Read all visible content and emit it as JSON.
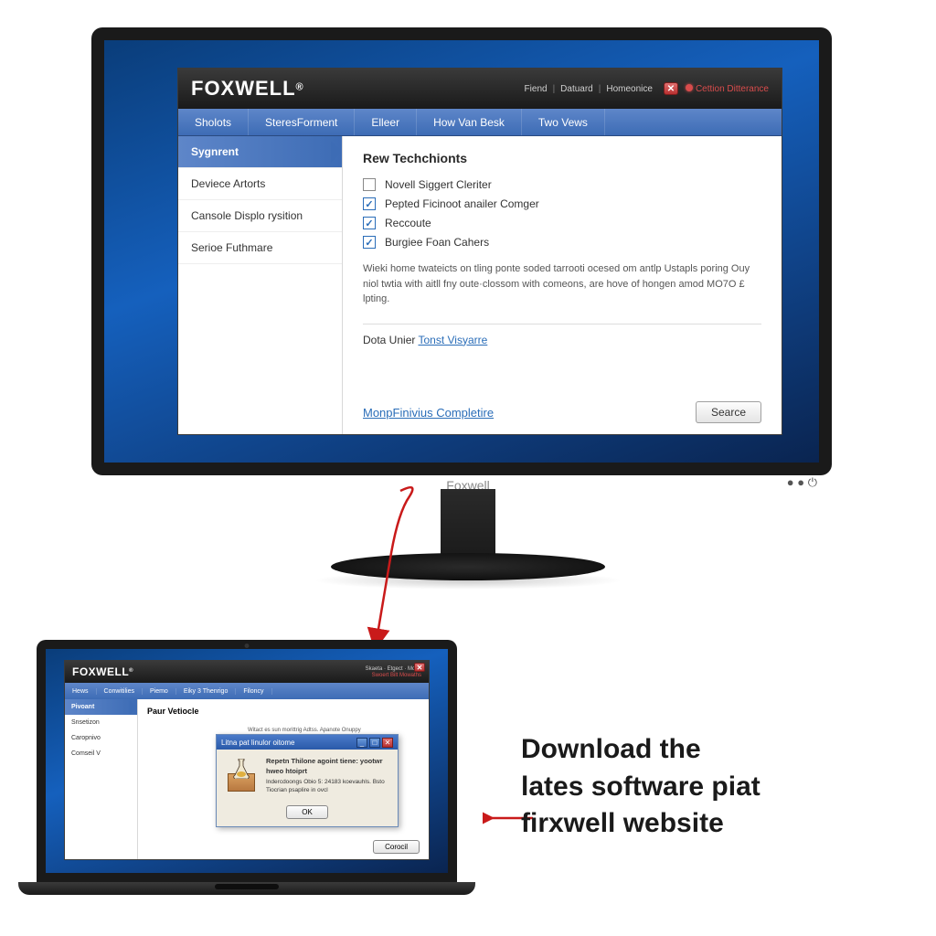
{
  "monitor": {
    "brand": "Foxwell",
    "app": {
      "logo": "FOXWELL",
      "reg": "®",
      "titlebar_links": [
        "Fiend",
        "Datuard",
        "Homeonice"
      ],
      "close_glyph": "✕",
      "status": "Cettion Ditterance",
      "nav": [
        "Sholots",
        "SteresForment",
        "Elleer",
        "How Van Besk",
        "Two Vews"
      ],
      "sidebar": {
        "items": [
          {
            "label": "Sygnrent",
            "active": true
          },
          {
            "label": "Deviece Artorts",
            "active": false
          },
          {
            "label": "Cansole Displo rysition",
            "active": false
          },
          {
            "label": "Serioe Futhmare",
            "active": false
          }
        ]
      },
      "content": {
        "heading": "Rew Techchionts",
        "checks": [
          {
            "checked": false,
            "label": "Novell Siggert Cleriter"
          },
          {
            "checked": true,
            "label": "Pepted Ficinoot anailer Comger"
          },
          {
            "checked": true,
            "label": "Reccoute"
          },
          {
            "checked": true,
            "label": "Burgiee Foan Cahers"
          }
        ],
        "desc": "Wieki home twateicts on tling ponte soded tarrooti ocesed om antlp Ustapls poring Ouy niol twtia with aitll fny oute·clossom with comeons, are hove of hongen amod MO7O £ lpting.",
        "data_label": "Dota Unier",
        "data_link": "Tonst Visyarre",
        "bottom_link": "MonpFinivius Completire",
        "button": "Searce"
      }
    }
  },
  "laptop": {
    "app": {
      "logo": "FOXWELL",
      "reg": "®",
      "titlebar_links": "Skaeta · Etgect · Mode",
      "status": "Swoert Bilt Mowaths",
      "close_glyph": "✕",
      "nav": [
        "Hews",
        "Conwitilies",
        "Piemo",
        "Eiky 3 Thenrigo",
        "Filoncy"
      ],
      "sidebar": {
        "items": [
          {
            "label": "Pivoant",
            "active": true
          },
          {
            "label": "Snsetizon",
            "active": false
          },
          {
            "label": "Caropnivo",
            "active": false
          },
          {
            "label": "Comseil V",
            "active": false
          }
        ]
      },
      "content": {
        "heading": "Paur Vetiocle",
        "desc": "Witact es sun morittrig Adtss. Apanote Onuppy Flomital fonacamat haur pmdf Tuit Ure inurminbid lytes Eb rut allon Tlocrian psaplire in ferdeat arengkse",
        "button": "Corocil"
      },
      "dialog": {
        "title": "Litna pat linulor oitome",
        "min": "_",
        "max": "□",
        "close": "✕",
        "heading": "Repetn Thilone agoint tiene: yootwr hweo htoiprt",
        "body": "Indercdoongs Obio 5: 24183 koevauhls. Bsto Tiocrian psaplire in ovcl",
        "ok": "OK"
      }
    }
  },
  "caption": {
    "line1": "Download the",
    "line2": "lates software piat",
    "line3": "firxwell website"
  }
}
